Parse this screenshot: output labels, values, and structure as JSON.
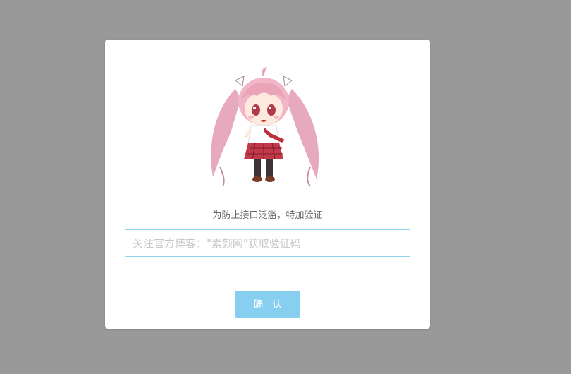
{
  "dialog": {
    "mascot_image": "anime-girl-mascot",
    "prompt": "为防止接口泛滥，特加验证",
    "input": {
      "value": "",
      "placeholder": "关注官方博客：\"素颜网\"获取验证码"
    },
    "confirm_label": "确 认"
  },
  "colors": {
    "backdrop": "#999999",
    "dialog_bg": "#ffffff",
    "input_border": "#8fd3ef",
    "button_bg": "#87cff0",
    "button_text": "#ffffff",
    "prompt_text": "#666666"
  }
}
